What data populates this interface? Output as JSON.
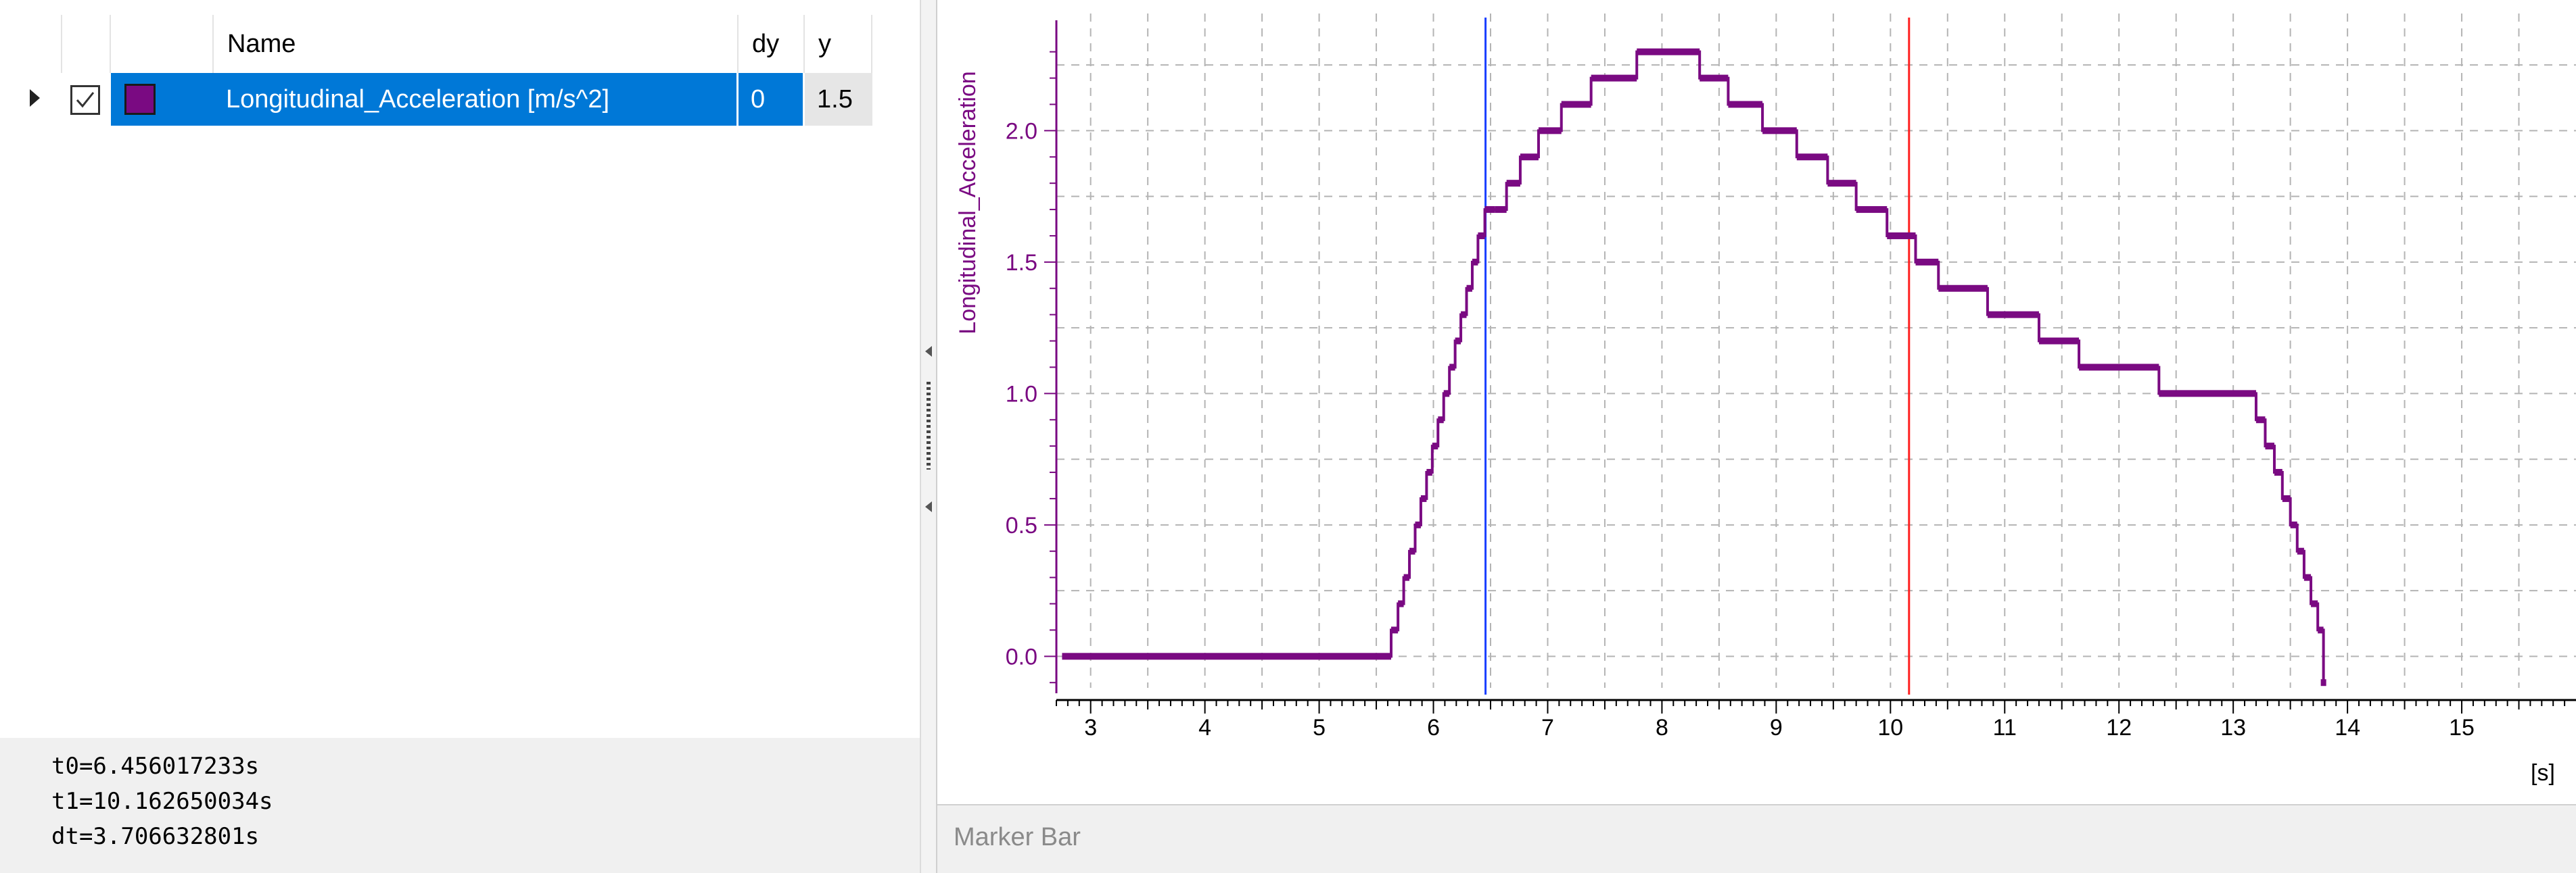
{
  "table": {
    "columns": [
      "Name",
      "dy",
      "y"
    ],
    "signals": [
      {
        "name": "Longitudinal_Acceleration [m/s^2]",
        "dy": "0",
        "y": "1.5",
        "color": "#7a0a82",
        "checked": true
      }
    ]
  },
  "cursors": {
    "t0_text": "t0=6.456017233s",
    "t1_text": "t1=10.162650034s",
    "dt_text": "dt=3.706632801s"
  },
  "marker_bar": {
    "label": "Marker Bar"
  },
  "colors": {
    "series": "#7a0a82",
    "cursor_t0": "#1a3fff",
    "cursor_t1": "#ff2020",
    "selection": "#0078d7"
  },
  "chart_data": {
    "type": "line",
    "ylabel": "Longitudinal_Acceleration",
    "xunit": "[s]",
    "xlim": [
      2.7,
      16.0
    ],
    "ylim": [
      -0.12,
      2.42
    ],
    "xticks": [
      "3",
      "4",
      "5",
      "6",
      "7",
      "8",
      "9",
      "10",
      "11",
      "12",
      "13",
      "14",
      "15"
    ],
    "yticks": [
      "0.0",
      "0.5",
      "1.0",
      "1.5",
      "2.0"
    ],
    "grid": true,
    "cursors": [
      6.456017233,
      10.162650034
    ],
    "series": [
      {
        "x": [
          2.75,
          5.63,
          5.69,
          5.74,
          5.79,
          5.84,
          5.89,
          5.94,
          5.99,
          6.04,
          6.09,
          6.14,
          6.19,
          6.24,
          6.29,
          6.34,
          6.39,
          6.45,
          6.54,
          6.64,
          6.76,
          6.92,
          7.12,
          7.38,
          7.78,
          8.33,
          8.58,
          8.88,
          9.18,
          9.45,
          9.7,
          9.97,
          10.22,
          10.42,
          10.85,
          11.3,
          11.65,
          12.35,
          13.2,
          13.28,
          13.36,
          13.43,
          13.5,
          13.56,
          13.62,
          13.68,
          13.74,
          13.79
        ],
        "y": [
          0.0,
          0.1,
          0.2,
          0.3,
          0.4,
          0.5,
          0.6,
          0.7,
          0.8,
          0.9,
          1.0,
          1.1,
          1.2,
          1.3,
          1.4,
          1.5,
          1.6,
          1.7,
          1.7,
          1.8,
          1.9,
          2.0,
          2.1,
          2.2,
          2.3,
          2.2,
          2.1,
          2.0,
          1.9,
          1.8,
          1.7,
          1.6,
          1.5,
          1.4,
          1.3,
          1.2,
          1.1,
          1.0,
          0.9,
          0.8,
          0.7,
          0.6,
          0.5,
          0.4,
          0.3,
          0.2,
          0.1,
          -0.1
        ],
        "x_end": [
          5.63,
          5.69,
          5.74,
          5.79,
          5.84,
          5.89,
          5.94,
          5.99,
          6.04,
          6.09,
          6.14,
          6.19,
          6.24,
          6.29,
          6.34,
          6.39,
          6.45,
          6.54,
          6.64,
          6.76,
          6.92,
          7.12,
          7.38,
          7.78,
          8.33,
          8.58,
          8.88,
          9.18,
          9.45,
          9.7,
          9.97,
          10.22,
          10.42,
          10.85,
          11.3,
          11.65,
          12.35,
          13.2,
          13.28,
          13.36,
          13.43,
          13.5,
          13.56,
          13.62,
          13.68,
          13.74,
          13.79,
          13.79
        ]
      }
    ]
  }
}
